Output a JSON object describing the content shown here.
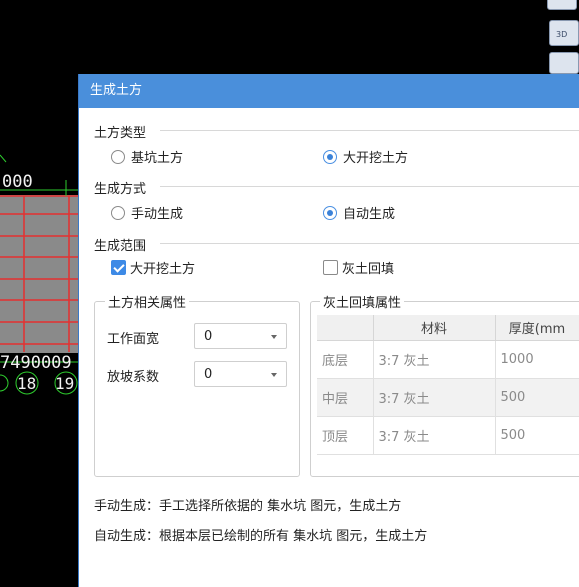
{
  "cad": {
    "labels": {
      "dim_left": "000",
      "dim_bottom": "7490009",
      "grid_a": "18",
      "grid_b": "19"
    },
    "view_button_3d": "3D"
  },
  "dialog": {
    "title": "生成土方",
    "earth_type": {
      "label": "土方类型",
      "options": [
        {
          "label": "基坑土方",
          "selected": false
        },
        {
          "label": "大开挖土方",
          "selected": true
        }
      ]
    },
    "gen_method": {
      "label": "生成方式",
      "options": [
        {
          "label": "手动生成",
          "selected": false
        },
        {
          "label": "自动生成",
          "selected": true
        }
      ]
    },
    "gen_range": {
      "label": "生成范围",
      "options": [
        {
          "label": "大开挖土方",
          "checked": true
        },
        {
          "label": "灰土回填",
          "checked": false
        }
      ]
    },
    "earth_props": {
      "title": "土方相关属性",
      "fields": [
        {
          "label": "工作面宽",
          "value": "0"
        },
        {
          "label": "放坡系数",
          "value": "0"
        }
      ]
    },
    "fill_props": {
      "title": "灰土回填属性",
      "columns": [
        "",
        "材料",
        "厚度(mm"
      ],
      "rows": [
        {
          "name": "底层",
          "material": "3:7 灰土",
          "thickness": "1000"
        },
        {
          "name": "中层",
          "material": "3:7 灰土",
          "thickness": "500"
        },
        {
          "name": "顶层",
          "material": "3:7 灰土",
          "thickness": "500"
        }
      ]
    },
    "descriptions": {
      "manual": "手动生成：手工选择所依据的 集水坑 图元，生成土方",
      "auto": "自动生成：根据本层已绘制的所有 集水坑 图元，生成土方"
    }
  }
}
